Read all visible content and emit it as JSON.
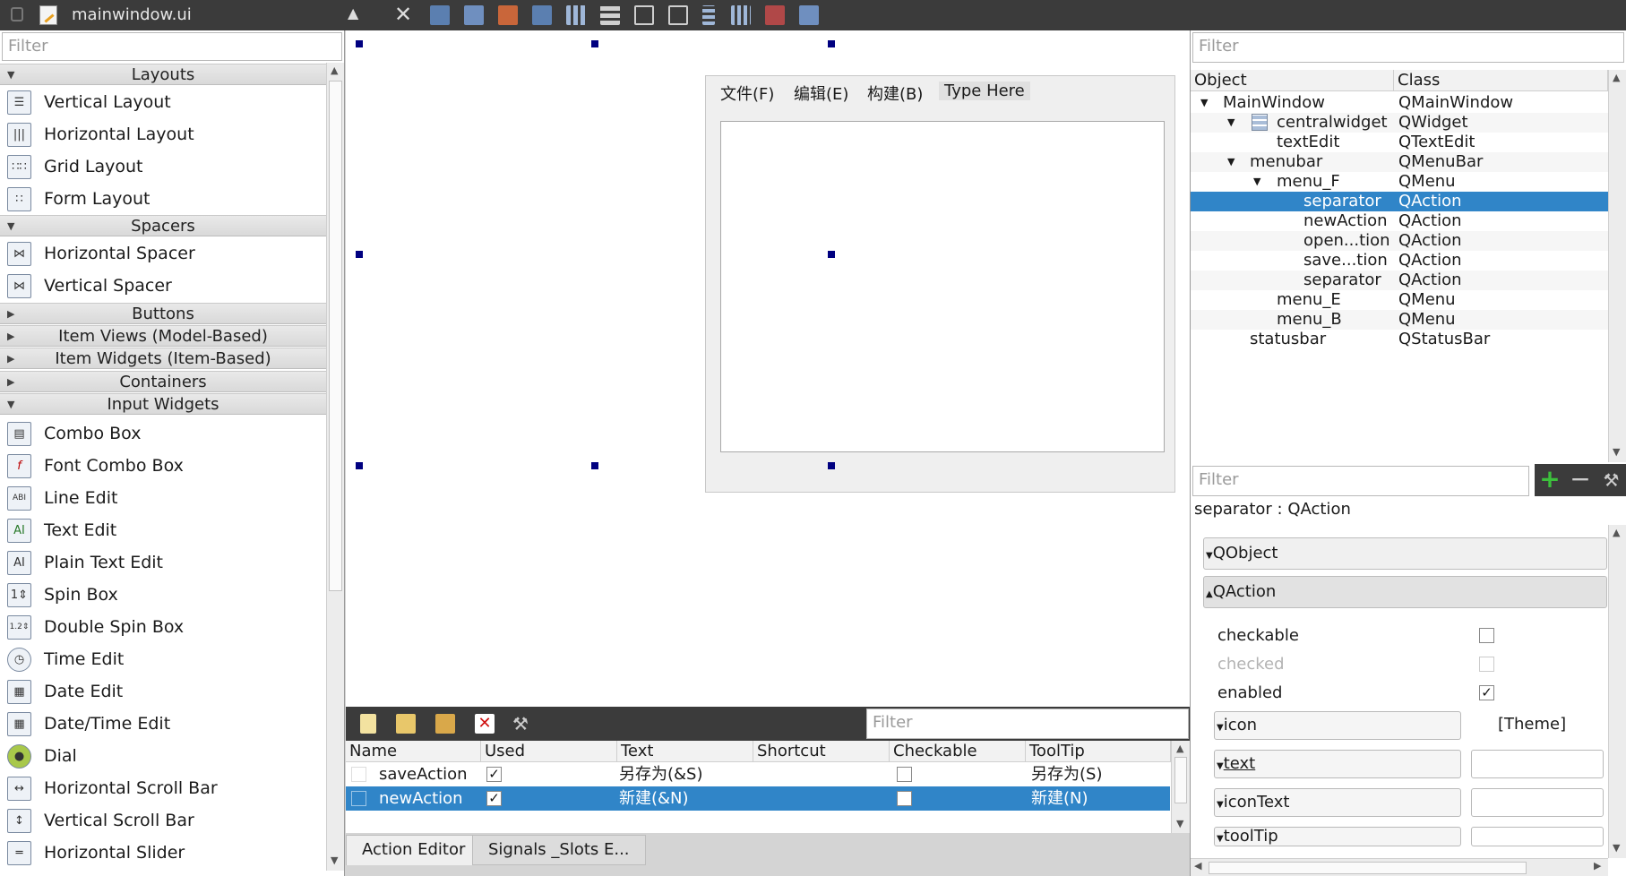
{
  "window": {
    "file_name": "mainwindow.ui"
  },
  "widget_box": {
    "filter_placeholder": "Filter",
    "categories": [
      {
        "label": "Layouts",
        "expanded": true
      },
      {
        "label": "Spacers",
        "expanded": true
      },
      {
        "label": "Buttons",
        "expanded": false
      },
      {
        "label": "Item Views (Model-Based)",
        "expanded": false
      },
      {
        "label": "Item Widgets (Item-Based)",
        "expanded": false
      },
      {
        "label": "Containers",
        "expanded": false
      },
      {
        "label": "Input Widgets",
        "expanded": true
      }
    ],
    "layouts": [
      {
        "label": "Vertical Layout",
        "icon": "vertical-layout-icon"
      },
      {
        "label": "Horizontal Layout",
        "icon": "horizontal-layout-icon"
      },
      {
        "label": "Grid Layout",
        "icon": "grid-layout-icon"
      },
      {
        "label": "Form Layout",
        "icon": "form-layout-icon"
      }
    ],
    "spacers": [
      {
        "label": "Horizontal Spacer",
        "icon": "horizontal-spacer-icon"
      },
      {
        "label": "Vertical Spacer",
        "icon": "vertical-spacer-icon"
      }
    ],
    "input_widgets": [
      {
        "label": "Combo Box",
        "icon": "combo-box-icon"
      },
      {
        "label": "Font Combo Box",
        "icon": "font-combo-box-icon"
      },
      {
        "label": "Line Edit",
        "icon": "line-edit-icon"
      },
      {
        "label": "Text Edit",
        "icon": "text-edit-icon"
      },
      {
        "label": "Plain Text Edit",
        "icon": "plain-text-edit-icon"
      },
      {
        "label": "Spin Box",
        "icon": "spin-box-icon"
      },
      {
        "label": "Double Spin Box",
        "icon": "double-spin-box-icon"
      },
      {
        "label": "Time Edit",
        "icon": "time-edit-icon"
      },
      {
        "label": "Date Edit",
        "icon": "date-edit-icon"
      },
      {
        "label": "Date/Time Edit",
        "icon": "date-time-edit-icon"
      },
      {
        "label": "Dial",
        "icon": "dial-icon"
      },
      {
        "label": "Horizontal Scroll Bar",
        "icon": "horizontal-scroll-bar-icon"
      },
      {
        "label": "Vertical Scroll Bar",
        "icon": "vertical-scroll-bar-icon"
      },
      {
        "label": "Horizontal Slider",
        "icon": "horizontal-slider-icon"
      }
    ]
  },
  "form": {
    "menus": [
      "文件(F)",
      "编辑(E)",
      "构建(B)",
      "Type Here"
    ]
  },
  "action_editor": {
    "filter_placeholder": "Filter",
    "columns": [
      "Name",
      "Used",
      "Text",
      "Shortcut",
      "Checkable",
      "ToolTip"
    ],
    "rows": [
      {
        "name": "saveAction",
        "used": true,
        "text": "另存为(&S)",
        "shortcut": "",
        "checkable": false,
        "tooltip": "另存为(S)",
        "selected": false
      },
      {
        "name": "newAction",
        "used": true,
        "text": "新建(&N)",
        "shortcut": "",
        "checkable": false,
        "tooltip": "新建(N)",
        "selected": true
      }
    ],
    "tabs": [
      "Action Editor",
      "Signals _Slots E..."
    ]
  },
  "object_inspector": {
    "filter_placeholder": "Filter",
    "columns": [
      "Object",
      "Class"
    ],
    "rows": [
      {
        "object": "MainWindow",
        "class": "QMainWindow",
        "depth": 0,
        "expander": "open"
      },
      {
        "object": "centralwidget",
        "class": "QWidget",
        "depth": 1,
        "expander": "open"
      },
      {
        "object": "textEdit",
        "class": "QTextEdit",
        "depth": 2,
        "expander": ""
      },
      {
        "object": "menubar",
        "class": "QMenuBar",
        "depth": 1,
        "expander": "open"
      },
      {
        "object": "menu_F",
        "class": "QMenu",
        "depth": 2,
        "expander": "open"
      },
      {
        "object": "separator",
        "class": "QAction",
        "depth": 3,
        "expander": "",
        "selected": true
      },
      {
        "object": "newAction",
        "class": "QAction",
        "depth": 3,
        "expander": ""
      },
      {
        "object": "open...tion",
        "class": "QAction",
        "depth": 3,
        "expander": ""
      },
      {
        "object": "save...tion",
        "class": "QAction",
        "depth": 3,
        "expander": ""
      },
      {
        "object": "separator",
        "class": "QAction",
        "depth": 3,
        "expander": ""
      },
      {
        "object": "menu_E",
        "class": "QMenu",
        "depth": 2,
        "expander": ""
      },
      {
        "object": "menu_B",
        "class": "QMenu",
        "depth": 2,
        "expander": ""
      },
      {
        "object": "statusbar",
        "class": "QStatusBar",
        "depth": 1,
        "expander": ""
      }
    ]
  },
  "property_editor": {
    "filter_placeholder": "Filter",
    "title": "separator : QAction",
    "groups": [
      "QObject",
      "QAction"
    ],
    "props": {
      "checkable": {
        "label": "checkable",
        "checked": false
      },
      "checked": {
        "label": "checked",
        "checked": false
      },
      "enabled": {
        "label": "enabled",
        "checked": true
      },
      "icon": {
        "label": "icon",
        "value": "[Theme]"
      },
      "text": {
        "label": "text",
        "value": ""
      },
      "iconText": {
        "label": "iconText",
        "value": ""
      },
      "toolTip": {
        "label": "toolTip",
        "value": ""
      }
    }
  },
  "colors": {
    "selection": "#3085c8",
    "toolbar": "#3b3b3b",
    "handle": "#000080"
  }
}
